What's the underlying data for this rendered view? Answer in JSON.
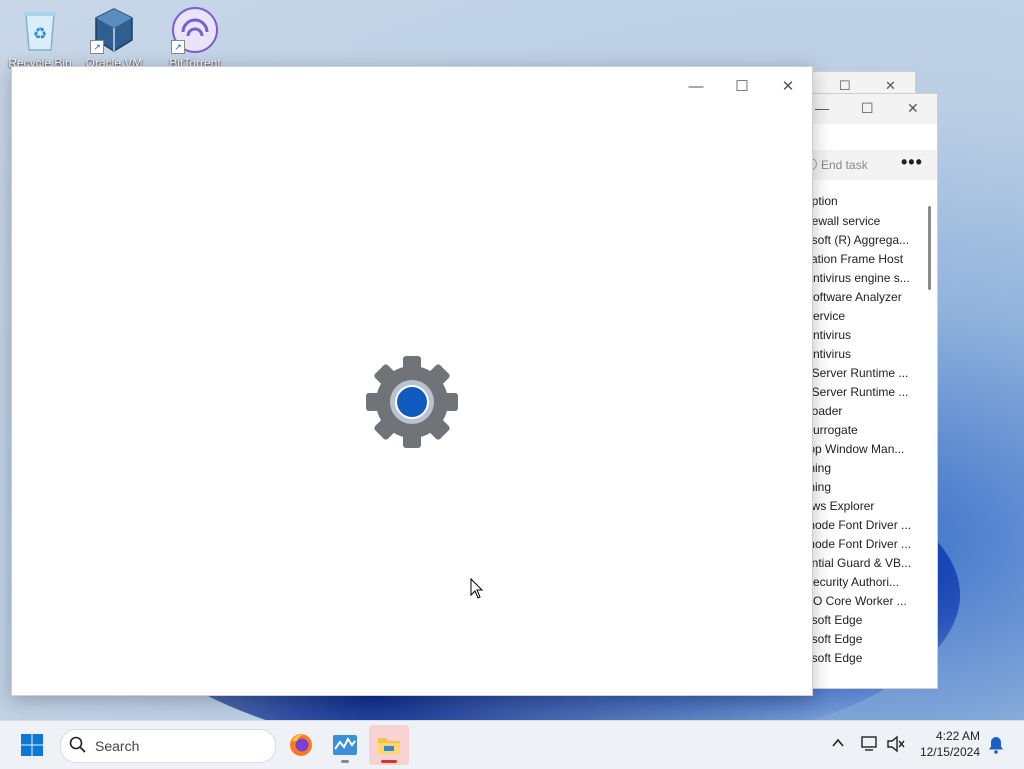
{
  "desktop": {
    "icons": [
      {
        "label": "Recycle Bin"
      },
      {
        "label": "Oracle VM"
      },
      {
        "label": "BitTorrent"
      }
    ]
  },
  "task_manager": {
    "end_task_label": "End task",
    "more_label": "•••",
    "column_header": "ription",
    "rows": [
      "irewall service",
      "osoft (R) Aggrega...",
      "cation Frame Host",
      "Antivirus engine s...",
      "Software Analyzer",
      "Service",
      "Antivirus",
      "Antivirus",
      "t Server Runtime ...",
      "t Server Runtime ...",
      "Loader",
      " Surrogate",
      "top Window Man...",
      "thing",
      "thing",
      "ows Explorer",
      "mode Font Driver ...",
      "mode Font Driver ...",
      "ential Guard & VB...",
      " Security Authori...",
      "SO Core Worker ...",
      "osoft Edge",
      "osoft Edge",
      "osoft Edge"
    ]
  },
  "settings_window": {
    "minimize": "—",
    "maximize": "☐",
    "close": "✕"
  },
  "taskbar": {
    "search_placeholder": "Search",
    "time": "4:22 AM",
    "date": "12/15/2024"
  },
  "colors": {
    "accent": "#0f5bbf",
    "gear": "#707478"
  }
}
